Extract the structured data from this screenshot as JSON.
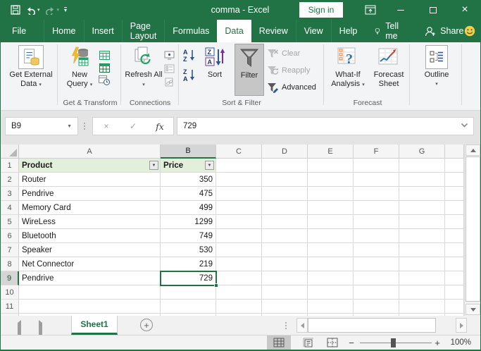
{
  "titlebar": {
    "title": "comma  -  Excel",
    "sign_in_label": "Sign in"
  },
  "menu": {
    "tabs": [
      "File",
      "Home",
      "Insert",
      "Page Layout",
      "Formulas",
      "Data",
      "Review",
      "View",
      "Help"
    ],
    "active_tab": "Data",
    "tell_me_label": "Tell me",
    "share_label": "Share"
  },
  "ribbon": {
    "get_external_data_label": "Get External Data",
    "new_query_label": "New Query",
    "get_transform_group": "Get & Transform",
    "refresh_all_label": "Refresh All",
    "connections_group": "Connections",
    "sort_label": "Sort",
    "filter_label": "Filter",
    "clear_label": "Clear",
    "reapply_label": "Reapply",
    "advanced_label": "Advanced",
    "sort_filter_group": "Sort & Filter",
    "what_if_label": "What-If Analysis",
    "forecast_sheet_label": "Forecast Sheet",
    "forecast_group": "Forecast",
    "outline_label": "Outline"
  },
  "formula_bar": {
    "name_box_value": "B9",
    "fx_label": "fx",
    "formula_value": "729"
  },
  "grid": {
    "column_headers": [
      "A",
      "B",
      "C",
      "D",
      "E",
      "F",
      "G"
    ],
    "selected": {
      "cell": "B9",
      "column": "B",
      "row": 9
    },
    "rows": [
      {
        "num": "1",
        "product": "Product",
        "price": "Price",
        "is_header": true
      },
      {
        "num": "2",
        "product": "Router",
        "price": "350"
      },
      {
        "num": "3",
        "product": "Pendrive",
        "price": "475"
      },
      {
        "num": "4",
        "product": "Memory Card",
        "price": "499"
      },
      {
        "num": "5",
        "product": "WireLess",
        "price": "1299"
      },
      {
        "num": "6",
        "product": "Bluetooth",
        "price": "749"
      },
      {
        "num": "7",
        "product": "Speaker",
        "price": "530"
      },
      {
        "num": "8",
        "product": "Net Connector",
        "price": "219"
      },
      {
        "num": "9",
        "product": "Pendrive",
        "price": "729"
      },
      {
        "num": "10",
        "product": "",
        "price": ""
      },
      {
        "num": "11",
        "product": "",
        "price": ""
      }
    ]
  },
  "sheet_tabs": {
    "active_sheet": "Sheet1"
  },
  "status_bar": {
    "zoom_level": "100%"
  },
  "icons": {
    "dropdown": "▾",
    "filter_dropdown": "▼",
    "cancel": "×",
    "enter": "✓",
    "new_sheet": "+",
    "zoom_out": "−",
    "zoom_in": "+"
  },
  "colors": {
    "excel_green": "#217346",
    "table_header_fill": "#E2EFDA",
    "selection_border": "#217346"
  }
}
